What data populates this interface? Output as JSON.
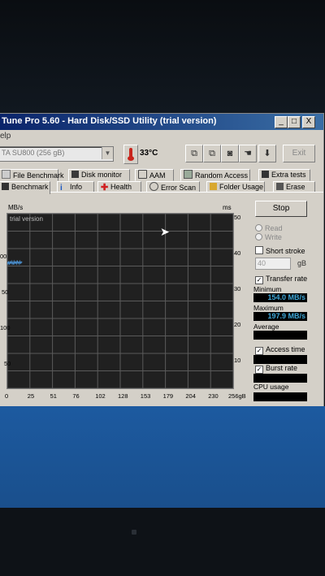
{
  "window": {
    "title": "Tune Pro 5.60 - Hard Disk/SSD Utility (trial version)",
    "menu": "elp",
    "controls": {
      "minimize": "_",
      "maximize": "□",
      "close": "X"
    }
  },
  "toolbar": {
    "drive": "TA SU800 (256 gB)",
    "temperature": "33°C",
    "exit_label": "Exit"
  },
  "tabs_top": [
    {
      "label": "File Benchmark",
      "icon": "file-benchmark-icon"
    },
    {
      "label": "Disk monitor",
      "icon": "disk-monitor-icon"
    },
    {
      "label": "AAM",
      "icon": "speaker-icon"
    },
    {
      "label": "Random Access",
      "icon": "random-access-icon"
    },
    {
      "label": "Extra tests",
      "icon": "extra-tests-icon"
    }
  ],
  "tabs_bottom": [
    {
      "label": "Benchmark",
      "icon": "benchmark-icon"
    },
    {
      "label": "Info",
      "icon": "info-icon"
    },
    {
      "label": "Health",
      "icon": "health-cross-icon"
    },
    {
      "label": "Error Scan",
      "icon": "error-scan-icon"
    },
    {
      "label": "Folder Usage",
      "icon": "folder-icon"
    },
    {
      "label": "Erase",
      "icon": "erase-icon"
    }
  ],
  "benchmark": {
    "stop_label": "Stop",
    "read_label": "Read",
    "write_label": "Write",
    "short_stroke_label": "Short stroke",
    "short_stroke_value": "40",
    "short_stroke_unit": "gB",
    "transfer_rate_label": "Transfer rate",
    "minimum_label": "Minimum",
    "minimum_value": "154.0 MB/s",
    "maximum_label": "Maximum",
    "maximum_value": "197.9 MB/s",
    "average_label": "Average",
    "average_value": "",
    "access_time_label": "Access time",
    "access_time_value": "",
    "burst_rate_label": "Burst rate",
    "burst_rate_value": "",
    "cpu_usage_label": "CPU usage",
    "cpu_usage_value": ""
  },
  "chart_data": {
    "type": "line",
    "watermark": "trial version",
    "y_left_label": "MB/s",
    "y_right_label": "ms",
    "y_left_ticks": [
      "50",
      "100",
      "50",
      "00"
    ],
    "y_right_ticks": [
      "50",
      "40",
      "30",
      "20",
      "10"
    ],
    "x_ticks": [
      "0",
      "25",
      "51",
      "76",
      "102",
      "128",
      "153",
      "179",
      "204",
      "230",
      "256gB"
    ],
    "xlim": [
      0,
      256
    ],
    "series": [
      {
        "values": [
          [
            0,
            181
          ],
          [
            0.8,
            178
          ],
          [
            1.6,
            182
          ],
          [
            2.4,
            177
          ],
          [
            3.2,
            181
          ],
          [
            4,
            179
          ],
          [
            4.8,
            182
          ],
          [
            5.6,
            178
          ],
          [
            6.4,
            181
          ],
          [
            7.2,
            177
          ],
          [
            8,
            182
          ],
          [
            8.8,
            179
          ],
          [
            9.6,
            181
          ],
          [
            10.4,
            178
          ],
          [
            11.2,
            183
          ],
          [
            12,
            179
          ],
          [
            12.8,
            181
          ],
          [
            13.6,
            178
          ],
          [
            14.4,
            182
          ],
          [
            15.2,
            179
          ],
          [
            16,
            181
          ],
          [
            16.8,
            180
          ]
        ]
      }
    ],
    "colors": {
      "read_line": "#4a90d0",
      "grid": "#5a5a5a",
      "background": "#202020"
    },
    "grid": true
  }
}
